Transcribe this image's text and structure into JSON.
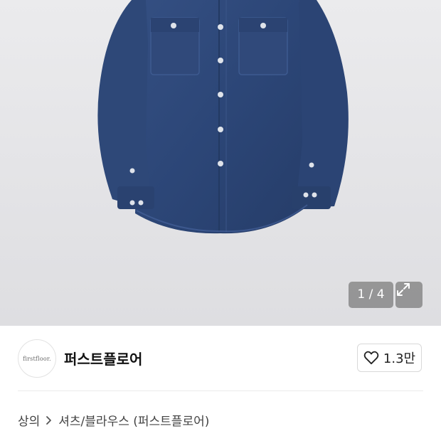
{
  "gallery": {
    "counter": "1 / 4",
    "image_subject": "denim-shirt",
    "expand_icon": "expand-arrows-icon"
  },
  "seller": {
    "logo_text": "firstfloor.",
    "name": "퍼스트플로어",
    "like_icon": "heart-outline-icon",
    "like_count": "1.3만"
  },
  "breadcrumb": {
    "items": [
      "상의",
      "셔츠/블라우스 (퍼스트플로어)"
    ],
    "separator_icon": "chevron-right-icon"
  },
  "colors": {
    "photo_bg": "#e6e6e9",
    "denim": "#2f4a7a",
    "overlay": "#787878"
  }
}
